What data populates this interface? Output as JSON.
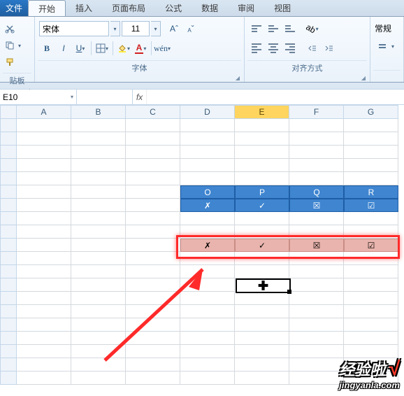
{
  "tabs": {
    "file": "文件",
    "home": "开始",
    "insert": "插入",
    "layout": "页面布局",
    "formula": "公式",
    "data": "数据",
    "review": "审阅",
    "view": "视图"
  },
  "ribbon": {
    "clipboard_title": "贴板",
    "font_title": "字体",
    "align_title": "对齐方式",
    "font_name": "宋体",
    "font_size": "11",
    "bold": "B",
    "italic": "I",
    "underline": "U",
    "fontA_big": "A",
    "fontA_small": "A",
    "number_title": "常规"
  },
  "namebox": "E10",
  "fx_label": "fx",
  "columns": [
    "A",
    "B",
    "C",
    "D",
    "E",
    "F",
    "G"
  ],
  "blue_table": {
    "headers": [
      "O",
      "P",
      "Q",
      "R"
    ],
    "row": [
      "✗",
      "✓",
      "☒",
      "☑"
    ]
  },
  "pink_row": [
    "✗",
    "✓",
    "☒",
    "☑"
  ],
  "watermark": {
    "line1": "经验啦",
    "check": "√",
    "line2": "jingyanla.com"
  },
  "chart_data": {
    "type": "table",
    "title": "",
    "tables": [
      {
        "fill": "blue",
        "headers": [
          "O",
          "P",
          "Q",
          "R"
        ],
        "rows": [
          [
            "✗",
            "✓",
            "☒",
            "☑"
          ]
        ]
      },
      {
        "fill": "pink",
        "headers": [],
        "rows": [
          [
            "✗",
            "✓",
            "☒",
            "☑"
          ]
        ]
      }
    ]
  }
}
